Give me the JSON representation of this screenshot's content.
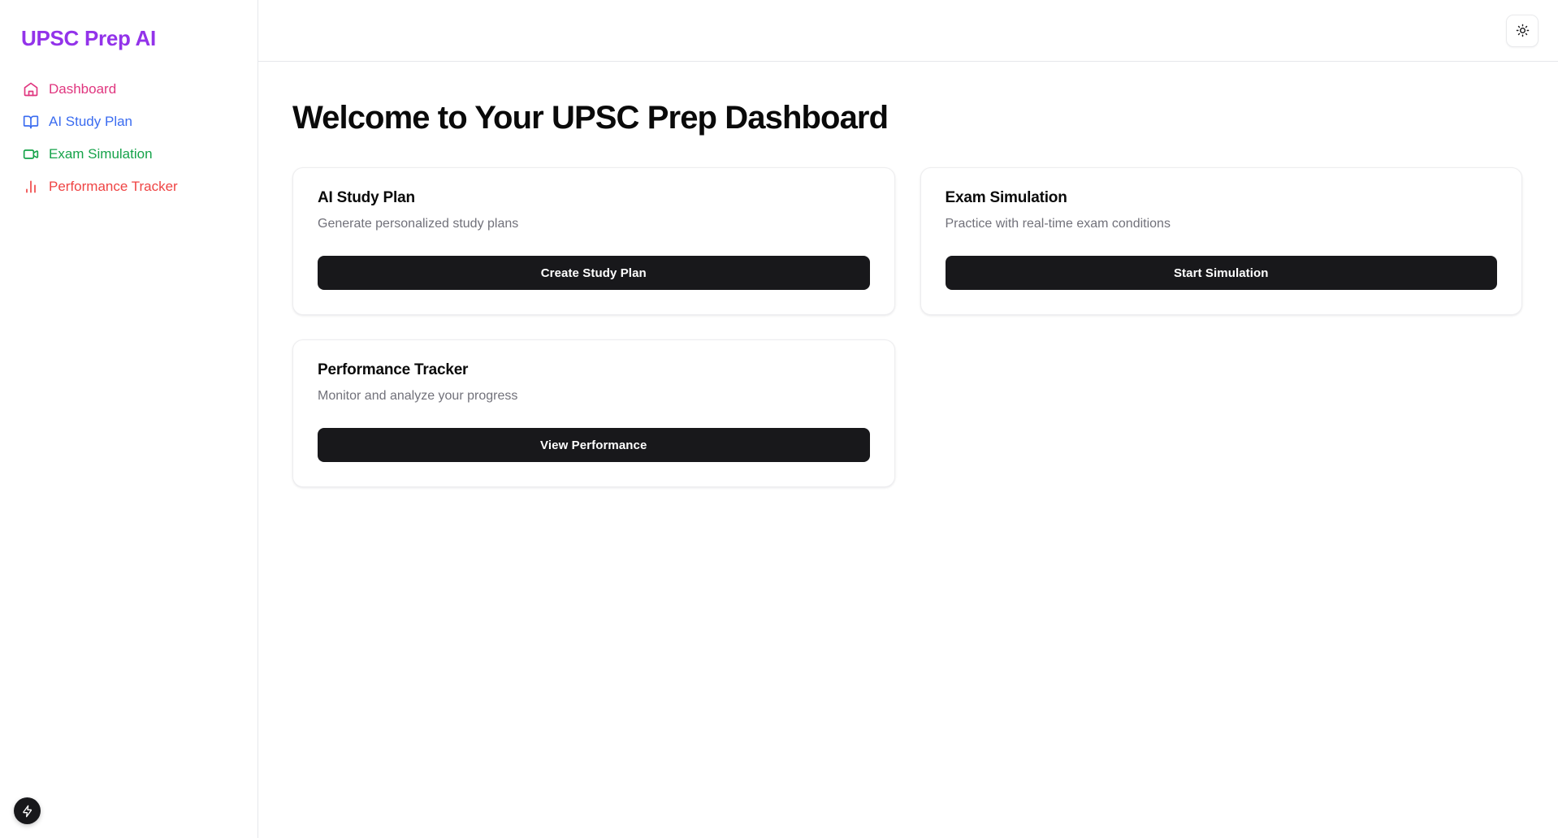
{
  "sidebar": {
    "brand": "UPSC Prep AI",
    "items": [
      {
        "label": "Dashboard",
        "icon": "home-icon",
        "color": "#e0367f"
      },
      {
        "label": "AI Study Plan",
        "icon": "book-open-icon",
        "color": "#3b6cf0"
      },
      {
        "label": "Exam Simulation",
        "icon": "video-icon",
        "color": "#16a34a"
      },
      {
        "label": "Performance Tracker",
        "icon": "bar-chart-icon",
        "color": "#ef4444"
      }
    ]
  },
  "topbar": {
    "theme_toggle_icon": "sun-icon"
  },
  "main": {
    "page_title": "Welcome to Your UPSC Prep Dashboard",
    "cards": [
      {
        "title": "AI Study Plan",
        "description": "Generate personalized study plans",
        "button_label": "Create Study Plan"
      },
      {
        "title": "Exam Simulation",
        "description": "Practice with real-time exam conditions",
        "button_label": "Start Simulation"
      },
      {
        "title": "Performance Tracker",
        "description": "Monitor and analyze your progress",
        "button_label": "View Performance"
      }
    ]
  },
  "fab": {
    "icon": "lightning-bolt-icon"
  },
  "colors": {
    "brand": "#9333ea",
    "button_bg": "#18181b",
    "border": "#e5e7eb",
    "muted_text": "#71717a"
  }
}
